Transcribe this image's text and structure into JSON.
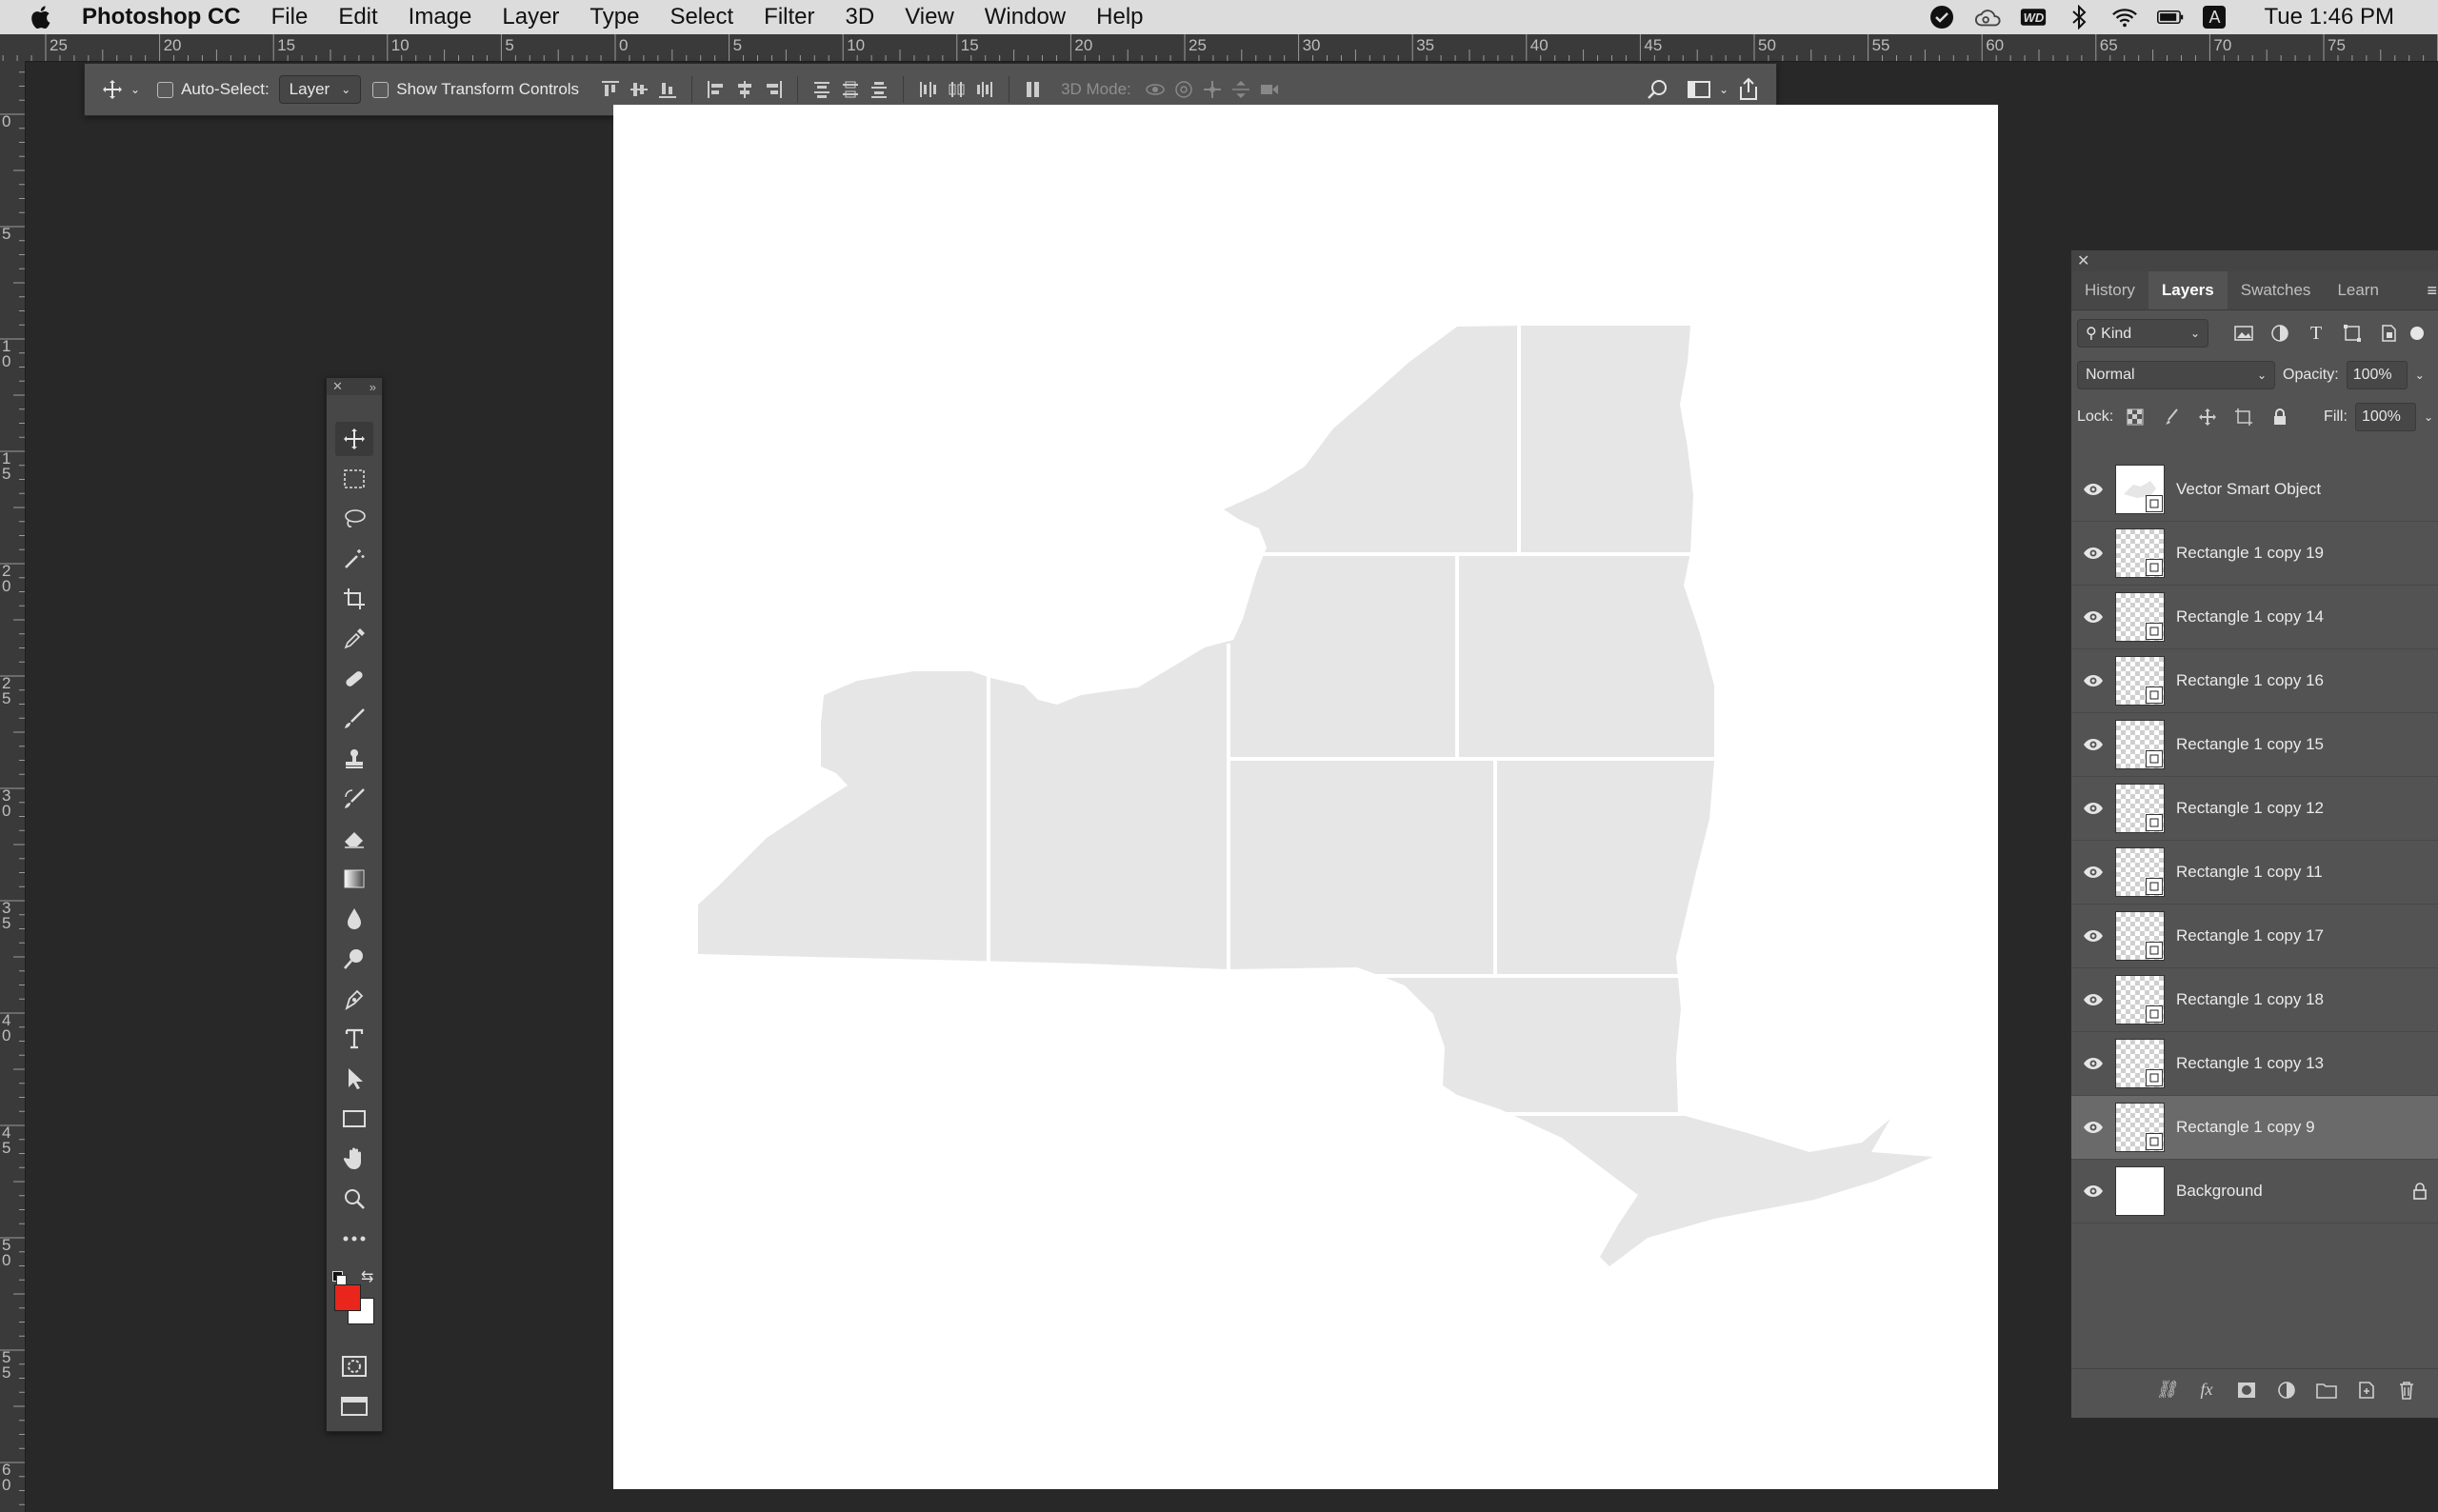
{
  "menubar": {
    "app_name": "Photoshop CC",
    "items": [
      "File",
      "Edit",
      "Image",
      "Layer",
      "Type",
      "Select",
      "Filter",
      "3D",
      "View",
      "Window",
      "Help"
    ],
    "clock": "Tue 1:46 PM",
    "status_icons": [
      "check-circle-icon",
      "creative-cloud-icon",
      "wd-icon",
      "bluetooth-icon",
      "wifi-icon",
      "battery-icon",
      "input-source-icon"
    ],
    "wd_label": "WD",
    "input_label": "A"
  },
  "rulers": {
    "top": [
      "25",
      "20",
      "15",
      "10",
      "5",
      "0",
      "5",
      "10",
      "15",
      "20",
      "25",
      "30",
      "35",
      "40",
      "45",
      "50",
      "55",
      "60",
      "65",
      "70",
      "75"
    ],
    "left": [
      "0",
      "5",
      "1\n0",
      "1\n5",
      "2\n0",
      "2\n5",
      "3\n0",
      "3\n5",
      "4\n0",
      "4\n5",
      "5\n0",
      "5\n5",
      "6\n0"
    ]
  },
  "options": {
    "auto_select_label": "Auto-Select:",
    "auto_select_value": "Layer",
    "show_transform_label": "Show Transform Controls",
    "mode_3d_label": "3D Mode:"
  },
  "toolbar": {
    "tools": [
      "move-tool",
      "marquee-tool",
      "lasso-tool",
      "magic-wand-tool",
      "crop-tool",
      "eyedropper-tool",
      "healing-brush-tool",
      "brush-tool",
      "clone-stamp-tool",
      "history-brush-tool",
      "eraser-tool",
      "gradient-tool",
      "blur-tool",
      "dodge-tool",
      "pen-tool",
      "type-tool",
      "path-selection-tool",
      "rectangle-tool",
      "hand-tool",
      "zoom-tool",
      "more-tools"
    ],
    "foreground_color": "#e8261c",
    "background_color": "#ffffff"
  },
  "panel": {
    "tabs": [
      "History",
      "Layers",
      "Swatches",
      "Learn"
    ],
    "active_tab": "Layers",
    "filter_kind": "Kind",
    "blend_mode": "Normal",
    "opacity_label": "Opacity:",
    "opacity_value": "100%",
    "lock_label": "Lock:",
    "fill_label": "Fill:",
    "fill_value": "100%",
    "layers": [
      {
        "name": "Vector Smart Object",
        "thumb": "vector"
      },
      {
        "name": "Rectangle 1 copy 19",
        "thumb": "checker"
      },
      {
        "name": "Rectangle 1 copy 14",
        "thumb": "checker"
      },
      {
        "name": "Rectangle 1 copy 16",
        "thumb": "checker"
      },
      {
        "name": "Rectangle 1 copy 15",
        "thumb": "checker"
      },
      {
        "name": "Rectangle 1 copy 12",
        "thumb": "checker"
      },
      {
        "name": "Rectangle 1 copy 11",
        "thumb": "checker"
      },
      {
        "name": "Rectangle 1 copy 17",
        "thumb": "checker"
      },
      {
        "name": "Rectangle 1 copy 18",
        "thumb": "checker"
      },
      {
        "name": "Rectangle 1 copy 13",
        "thumb": "checker"
      },
      {
        "name": "Rectangle 1 copy 9",
        "thumb": "checker",
        "selected": true
      },
      {
        "name": "Background",
        "thumb": "white",
        "locked": true
      }
    ]
  },
  "map_fill": "#e6e6e6"
}
